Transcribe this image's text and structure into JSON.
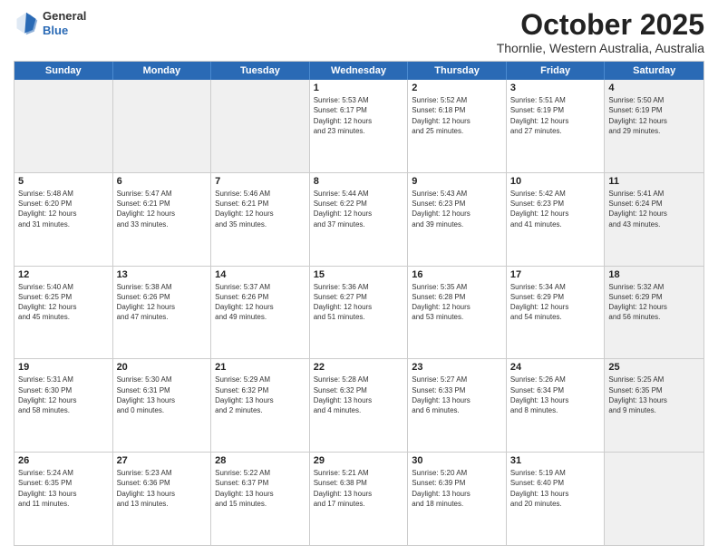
{
  "logo": {
    "general": "General",
    "blue": "Blue"
  },
  "header": {
    "month": "October 2025",
    "location": "Thornlie, Western Australia, Australia"
  },
  "days": [
    "Sunday",
    "Monday",
    "Tuesday",
    "Wednesday",
    "Thursday",
    "Friday",
    "Saturday"
  ],
  "weeks": [
    [
      {
        "day": "",
        "info": "",
        "shade": true
      },
      {
        "day": "",
        "info": "",
        "shade": true
      },
      {
        "day": "",
        "info": "",
        "shade": true
      },
      {
        "day": "1",
        "info": "Sunrise: 5:53 AM\nSunset: 6:17 PM\nDaylight: 12 hours\nand 23 minutes."
      },
      {
        "day": "2",
        "info": "Sunrise: 5:52 AM\nSunset: 6:18 PM\nDaylight: 12 hours\nand 25 minutes."
      },
      {
        "day": "3",
        "info": "Sunrise: 5:51 AM\nSunset: 6:19 PM\nDaylight: 12 hours\nand 27 minutes."
      },
      {
        "day": "4",
        "info": "Sunrise: 5:50 AM\nSunset: 6:19 PM\nDaylight: 12 hours\nand 29 minutes.",
        "shade": true
      }
    ],
    [
      {
        "day": "5",
        "info": "Sunrise: 5:48 AM\nSunset: 6:20 PM\nDaylight: 12 hours\nand 31 minutes."
      },
      {
        "day": "6",
        "info": "Sunrise: 5:47 AM\nSunset: 6:21 PM\nDaylight: 12 hours\nand 33 minutes."
      },
      {
        "day": "7",
        "info": "Sunrise: 5:46 AM\nSunset: 6:21 PM\nDaylight: 12 hours\nand 35 minutes."
      },
      {
        "day": "8",
        "info": "Sunrise: 5:44 AM\nSunset: 6:22 PM\nDaylight: 12 hours\nand 37 minutes."
      },
      {
        "day": "9",
        "info": "Sunrise: 5:43 AM\nSunset: 6:23 PM\nDaylight: 12 hours\nand 39 minutes."
      },
      {
        "day": "10",
        "info": "Sunrise: 5:42 AM\nSunset: 6:23 PM\nDaylight: 12 hours\nand 41 minutes."
      },
      {
        "day": "11",
        "info": "Sunrise: 5:41 AM\nSunset: 6:24 PM\nDaylight: 12 hours\nand 43 minutes.",
        "shade": true
      }
    ],
    [
      {
        "day": "12",
        "info": "Sunrise: 5:40 AM\nSunset: 6:25 PM\nDaylight: 12 hours\nand 45 minutes."
      },
      {
        "day": "13",
        "info": "Sunrise: 5:38 AM\nSunset: 6:26 PM\nDaylight: 12 hours\nand 47 minutes."
      },
      {
        "day": "14",
        "info": "Sunrise: 5:37 AM\nSunset: 6:26 PM\nDaylight: 12 hours\nand 49 minutes."
      },
      {
        "day": "15",
        "info": "Sunrise: 5:36 AM\nSunset: 6:27 PM\nDaylight: 12 hours\nand 51 minutes."
      },
      {
        "day": "16",
        "info": "Sunrise: 5:35 AM\nSunset: 6:28 PM\nDaylight: 12 hours\nand 53 minutes."
      },
      {
        "day": "17",
        "info": "Sunrise: 5:34 AM\nSunset: 6:29 PM\nDaylight: 12 hours\nand 54 minutes."
      },
      {
        "day": "18",
        "info": "Sunrise: 5:32 AM\nSunset: 6:29 PM\nDaylight: 12 hours\nand 56 minutes.",
        "shade": true
      }
    ],
    [
      {
        "day": "19",
        "info": "Sunrise: 5:31 AM\nSunset: 6:30 PM\nDaylight: 12 hours\nand 58 minutes."
      },
      {
        "day": "20",
        "info": "Sunrise: 5:30 AM\nSunset: 6:31 PM\nDaylight: 13 hours\nand 0 minutes."
      },
      {
        "day": "21",
        "info": "Sunrise: 5:29 AM\nSunset: 6:32 PM\nDaylight: 13 hours\nand 2 minutes."
      },
      {
        "day": "22",
        "info": "Sunrise: 5:28 AM\nSunset: 6:32 PM\nDaylight: 13 hours\nand 4 minutes."
      },
      {
        "day": "23",
        "info": "Sunrise: 5:27 AM\nSunset: 6:33 PM\nDaylight: 13 hours\nand 6 minutes."
      },
      {
        "day": "24",
        "info": "Sunrise: 5:26 AM\nSunset: 6:34 PM\nDaylight: 13 hours\nand 8 minutes."
      },
      {
        "day": "25",
        "info": "Sunrise: 5:25 AM\nSunset: 6:35 PM\nDaylight: 13 hours\nand 9 minutes.",
        "shade": true
      }
    ],
    [
      {
        "day": "26",
        "info": "Sunrise: 5:24 AM\nSunset: 6:35 PM\nDaylight: 13 hours\nand 11 minutes."
      },
      {
        "day": "27",
        "info": "Sunrise: 5:23 AM\nSunset: 6:36 PM\nDaylight: 13 hours\nand 13 minutes."
      },
      {
        "day": "28",
        "info": "Sunrise: 5:22 AM\nSunset: 6:37 PM\nDaylight: 13 hours\nand 15 minutes."
      },
      {
        "day": "29",
        "info": "Sunrise: 5:21 AM\nSunset: 6:38 PM\nDaylight: 13 hours\nand 17 minutes."
      },
      {
        "day": "30",
        "info": "Sunrise: 5:20 AM\nSunset: 6:39 PM\nDaylight: 13 hours\nand 18 minutes."
      },
      {
        "day": "31",
        "info": "Sunrise: 5:19 AM\nSunset: 6:40 PM\nDaylight: 13 hours\nand 20 minutes."
      },
      {
        "day": "",
        "info": "",
        "shade": true
      }
    ]
  ]
}
